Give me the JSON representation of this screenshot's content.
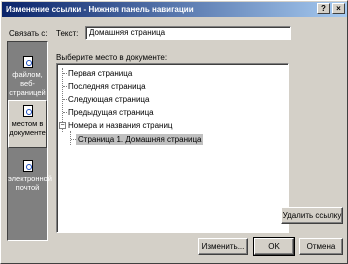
{
  "window": {
    "title": "Изменение ссылки - Нижняя панель навигации",
    "help_label": "?",
    "close_label": "×"
  },
  "link_to": {
    "label": "Связать с:",
    "items": [
      {
        "label": "файлом, веб-страницей",
        "icon": "web-page-icon",
        "selected": false
      },
      {
        "label": "местом в документе",
        "icon": "place-in-document-icon",
        "selected": true
      },
      {
        "label": "электронной почтой",
        "icon": "email-icon",
        "selected": false
      }
    ]
  },
  "text_field": {
    "label": "Текст:",
    "value": "Домашняя страница"
  },
  "place_list": {
    "label": "Выберите место в документе:",
    "items": [
      {
        "label": "Первая страница",
        "level": 1
      },
      {
        "label": "Последняя страница",
        "level": 1
      },
      {
        "label": "Следующая страница",
        "level": 1
      },
      {
        "label": "Предыдущая страница",
        "level": 1
      },
      {
        "label": "Номера и названия страниц",
        "level": 1,
        "expanded": true,
        "expander": "−"
      },
      {
        "label": "Страница 1. Домашняя страница",
        "level": 2,
        "selected": true
      }
    ]
  },
  "buttons": {
    "remove_link": "Удалить ссылку",
    "change": "Изменить...",
    "ok": "OK",
    "cancel": "Отмена"
  }
}
